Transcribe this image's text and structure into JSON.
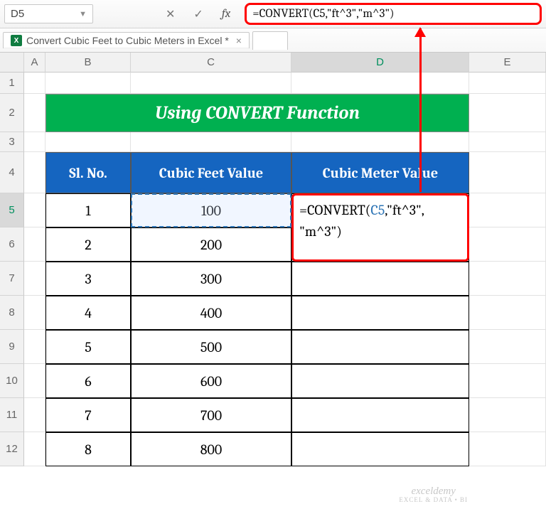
{
  "name_box": "D5",
  "formula_bar": "=CONVERT(C5,\"ft^3\",\"m^3\")",
  "workbook_tab": "Convert Cubic Feet to Cubic Meters in Excel *",
  "columns": [
    "",
    "A",
    "B",
    "C",
    "D",
    "E"
  ],
  "selected_col_index": 4,
  "rows": [
    "1",
    "2",
    "3",
    "4",
    "5",
    "6",
    "7",
    "8",
    "9",
    "10",
    "11",
    "12"
  ],
  "selected_row_index": 4,
  "title": "Using CONVERT Function",
  "headers": {
    "b": "Sl. No.",
    "c": "Cubic Feet Value",
    "d": "Cubic Meter Value"
  },
  "data": [
    {
      "sl": "1",
      "ft": "100"
    },
    {
      "sl": "2",
      "ft": "200"
    },
    {
      "sl": "3",
      "ft": "300"
    },
    {
      "sl": "4",
      "ft": "400"
    },
    {
      "sl": "5",
      "ft": "500"
    },
    {
      "sl": "6",
      "ft": "600"
    },
    {
      "sl": "7",
      "ft": "700"
    },
    {
      "sl": "8",
      "ft": "800"
    }
  ],
  "cell_formula": {
    "part1": "=CONVERT(",
    "ref": "C5",
    "part2": ",\"ft^3\",",
    "part3": "\"m^3\")"
  },
  "watermark": {
    "brand": "exceldemy",
    "tag": "EXCEL & DATA • BI"
  }
}
